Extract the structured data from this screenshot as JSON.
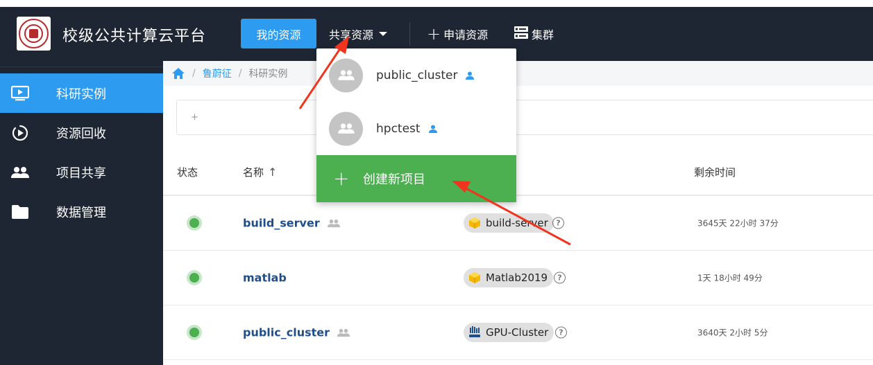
{
  "app": {
    "title": "校级公共计算云平台"
  },
  "nav": {
    "mine": "我的资源",
    "shared": "共享资源",
    "apply": "申请资源",
    "cluster": "集群"
  },
  "sidebar": {
    "items": [
      {
        "label": "科研实例",
        "icon": "monitor-play-icon",
        "active": true
      },
      {
        "label": "资源回收",
        "icon": "recycle-icon",
        "active": false
      },
      {
        "label": "项目共享",
        "icon": "people-icon",
        "active": false
      },
      {
        "label": "数据管理",
        "icon": "folder-icon",
        "active": false
      }
    ]
  },
  "breadcrumb": {
    "user": "鲁蔚征",
    "current": "科研实例"
  },
  "search": {
    "placeholder": "+"
  },
  "table": {
    "headers": {
      "status": "状态",
      "name": "名称",
      "name_sort": "↑",
      "remaining": "剩余时间"
    },
    "rows": [
      {
        "name": "build_server",
        "shared": true,
        "image": "build-server",
        "image_icon": "cube-icon",
        "remaining": "3645天 22小时 37分",
        "status_color": "#4caf50"
      },
      {
        "name": "matlab",
        "shared": false,
        "image": "Matlab2019",
        "image_icon": "cube-icon",
        "remaining": "1天 18小时 49分",
        "status_color": "#4caf50"
      },
      {
        "name": "public_cluster",
        "shared": true,
        "image": "GPU-Cluster",
        "image_icon": "slurm-icon",
        "remaining": "3640天 2小时 5分",
        "status_color": "#4caf50"
      }
    ]
  },
  "dropdown": {
    "items": [
      {
        "label": "public_cluster"
      },
      {
        "label": "hpctest"
      }
    ],
    "create": "创建新项目"
  },
  "colors": {
    "header_bg": "#1e2633",
    "accent": "#2d9bf0",
    "create_green": "#4caf50",
    "arrow_red": "#f0341e"
  }
}
